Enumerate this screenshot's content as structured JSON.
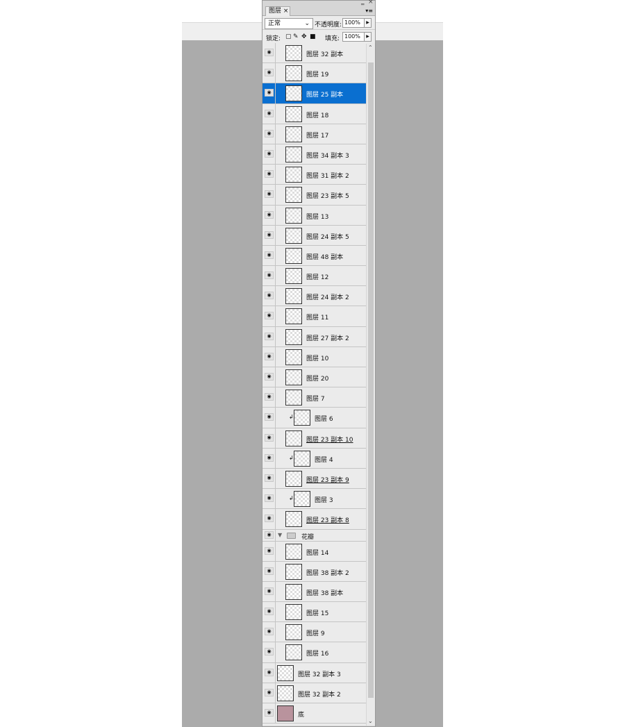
{
  "panel": {
    "tab": "图层",
    "tab_close": "×",
    "collapse": "‗",
    "close": "×",
    "menu": "▾≡"
  },
  "blend": {
    "mode": "正常",
    "opacity_label": "不透明度:",
    "opacity": "100%"
  },
  "lock": {
    "label": "锁定:",
    "fill_label": "填充:",
    "fill": "100%",
    "icons": [
      "lock-transparent-icon",
      "lock-paint-icon",
      "lock-move-icon",
      "lock-all-icon"
    ]
  },
  "colors": {
    "selected": "#0a6fd0",
    "base_fill": "#b9939d",
    "canvas": "#ababab"
  },
  "layers": [
    {
      "name": "图层 32 副本",
      "indent": 1
    },
    {
      "name": "图层 19",
      "indent": 1
    },
    {
      "name": "图层 25 副本",
      "indent": 1,
      "selected": true
    },
    {
      "name": "图层 18",
      "indent": 1
    },
    {
      "name": "图层 17",
      "indent": 1
    },
    {
      "name": "图层 34 副本 3",
      "indent": 1
    },
    {
      "name": "图层 31 副本 2",
      "indent": 1
    },
    {
      "name": "图层 23 副本 5",
      "indent": 1
    },
    {
      "name": "图层 13",
      "indent": 1
    },
    {
      "name": "图层 24 副本 5",
      "indent": 1
    },
    {
      "name": "图层 48 副本",
      "indent": 1
    },
    {
      "name": "图层 12",
      "indent": 1
    },
    {
      "name": "图层 24 副本 2",
      "indent": 1
    },
    {
      "name": "图层 11",
      "indent": 1
    },
    {
      "name": "图层 27 副本 2",
      "indent": 1
    },
    {
      "name": "图层 10",
      "indent": 1
    },
    {
      "name": "图层 20",
      "indent": 1
    },
    {
      "name": "图层 7",
      "indent": 1
    },
    {
      "name": "图层 6",
      "indent": 1,
      "clipped": true
    },
    {
      "name": "图层 23 副本 10",
      "indent": 1,
      "underline": true
    },
    {
      "name": "图层 4",
      "indent": 1,
      "clipped": true
    },
    {
      "name": "图层 23 副本 9",
      "indent": 1,
      "underline": true
    },
    {
      "name": "图层 3",
      "indent": 1,
      "clipped": true
    },
    {
      "name": "图层 23 副本 8",
      "indent": 1,
      "underline": true
    },
    {
      "name": "花瓣",
      "group": true
    },
    {
      "name": "图层 14",
      "indent": 1
    },
    {
      "name": "图层 38 副本 2",
      "indent": 1
    },
    {
      "name": "图层 38 副本",
      "indent": 1
    },
    {
      "name": "图层 15",
      "indent": 1
    },
    {
      "name": "图层 9",
      "indent": 1
    },
    {
      "name": "图层 16",
      "indent": 1
    },
    {
      "name": "图层 32 副本 3",
      "indent": 0
    },
    {
      "name": "图层 32 副本 2",
      "indent": 0
    },
    {
      "name": "底",
      "indent": 0,
      "solid": true
    }
  ]
}
